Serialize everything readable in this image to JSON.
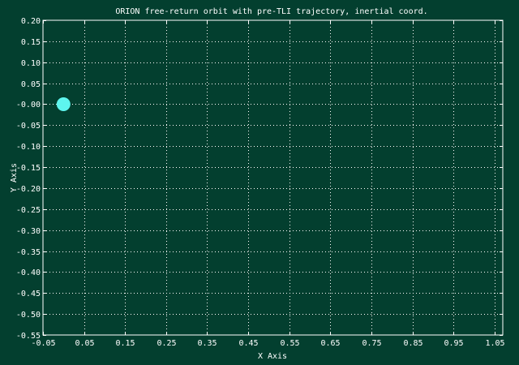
{
  "chart_data": {
    "type": "scatter",
    "title": "ORION free-return orbit with pre-TLI trajectory, inertial coord.",
    "xlabel": "X Axis",
    "ylabel": "Y Axis",
    "xlim": [
      -0.05,
      1.07
    ],
    "ylim": [
      -0.55,
      0.2
    ],
    "xticks": [
      "-0.05",
      "0.05",
      "0.15",
      "0.25",
      "0.35",
      "0.45",
      "0.55",
      "0.65",
      "0.75",
      "0.85",
      "0.95",
      "1.05"
    ],
    "xtick_values": [
      -0.05,
      0.05,
      0.15,
      0.25,
      0.35,
      0.45,
      0.55,
      0.65,
      0.75,
      0.85,
      0.95,
      1.05
    ],
    "yticks": [
      "0.20",
      "0.15",
      "0.10",
      "0.05",
      "-0.00",
      "-0.05",
      "-0.10",
      "-0.15",
      "-0.20",
      "-0.25",
      "-0.30",
      "-0.35",
      "-0.40",
      "-0.45",
      "-0.50",
      "-0.55"
    ],
    "ytick_values": [
      0.2,
      0.15,
      0.1,
      0.05,
      0.0,
      -0.05,
      -0.1,
      -0.15,
      -0.2,
      -0.25,
      -0.3,
      -0.35,
      -0.4,
      -0.45,
      -0.5,
      -0.55
    ],
    "grid": true,
    "points": [
      {
        "x": 0.0,
        "y": 0.0,
        "marker": "earth"
      }
    ],
    "colors": {
      "background": "#033f2f",
      "foreground": "#ffffff",
      "marker": "#5ef5ee"
    }
  }
}
